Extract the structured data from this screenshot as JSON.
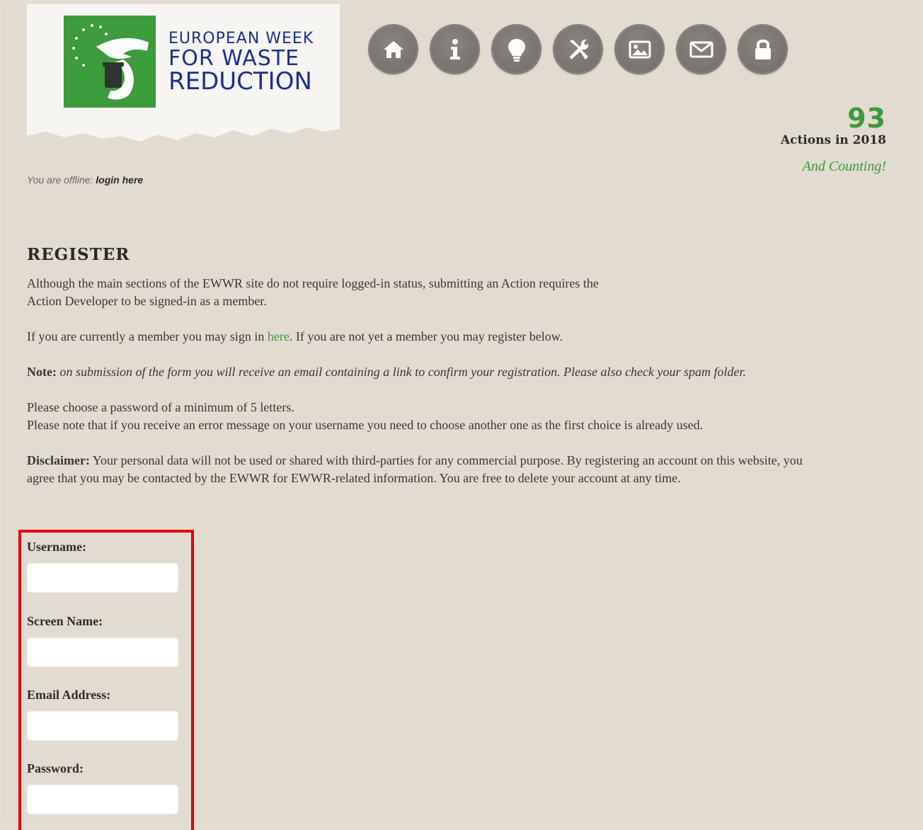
{
  "logo": {
    "line1": "EUROPEAN WEEK",
    "line2": "FOR WASTE",
    "line3": "REDUCTION"
  },
  "nav": [
    {
      "icon": "home-icon"
    },
    {
      "icon": "info-icon"
    },
    {
      "icon": "lightbulb-icon"
    },
    {
      "icon": "tools-icon"
    },
    {
      "icon": "image-icon"
    },
    {
      "icon": "mail-icon"
    },
    {
      "icon": "lock-icon"
    }
  ],
  "counter": {
    "number": "93",
    "label": "Actions in 2018",
    "tagline": "And Counting!"
  },
  "status": {
    "prefix": "You are offline: ",
    "link": "login here"
  },
  "page": {
    "title": "REGISTER",
    "para1": "Although the main sections of the EWWR site do not require logged-in status, submitting an Action requires the Action Developer to be signed-in as a member.",
    "para2_before": "If you are currently a member you may sign in ",
    "para2_link": "here",
    "para2_after": ". If you are not yet a member you may register below.",
    "note_label": "Note:",
    "note_text": " on submission of the form you will receive an email containing a link to confirm your registration. Please also check your spam folder.",
    "pwd_line1": "Please choose a password of a minimum of 5 letters.",
    "pwd_line2": "Please note that if you receive an error message on your username you need to choose another one as the first choice is already used.",
    "disclaimer_label": "Disclaimer:",
    "disclaimer_text": " Your personal data will not be used or shared with third-parties for any commercial purpose. By registering an account on this website, you agree that you may be contacted by the EWWR for EWWR-related information. You are free to delete your account at any time."
  },
  "form": {
    "username_label": "Username:",
    "username_value": "",
    "screenname_label": "Screen Name:",
    "screenname_value": "",
    "email_label": "Email Address:",
    "email_value": "",
    "password_label": "Password:",
    "password_value": ""
  },
  "colors": {
    "background": "#e2dbcf",
    "brand_green": "#3b9a3a",
    "brand_blue": "#1f2f8f",
    "nav_gray": "#7a7470",
    "highlight_red": "#e0000f"
  }
}
